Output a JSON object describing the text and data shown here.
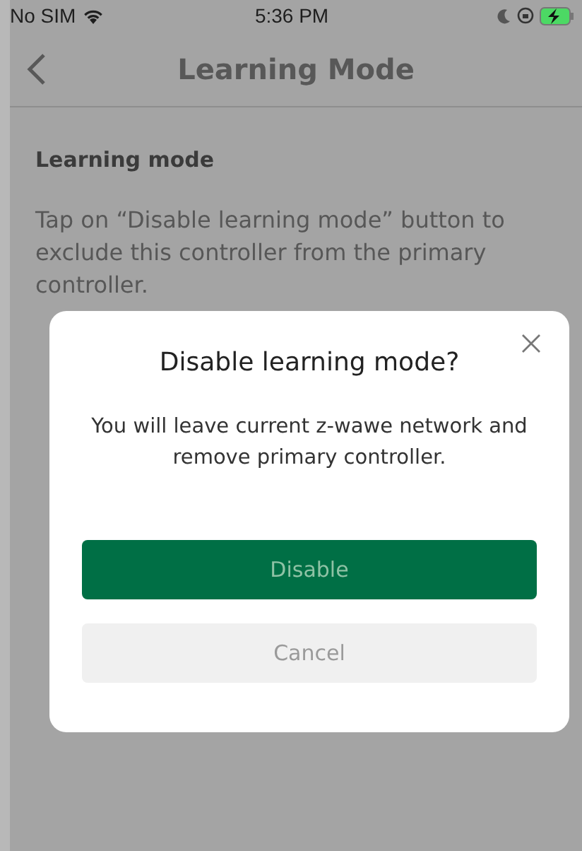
{
  "status_bar": {
    "carrier": "No SIM",
    "time": "5:36 PM",
    "charging": true
  },
  "header": {
    "title": "Learning Mode"
  },
  "content": {
    "heading": "Learning mode",
    "paragraph": "Tap on “Disable learning mode” button to exclude this controller from the primary controller."
  },
  "dialog": {
    "title": "Disable learning mode?",
    "message": "You will leave current z-wawe network and remove primary controller.",
    "buttons": [
      {
        "label": "Disable",
        "kind": "primary"
      },
      {
        "label": "Cancel",
        "kind": "secondary"
      }
    ]
  }
}
